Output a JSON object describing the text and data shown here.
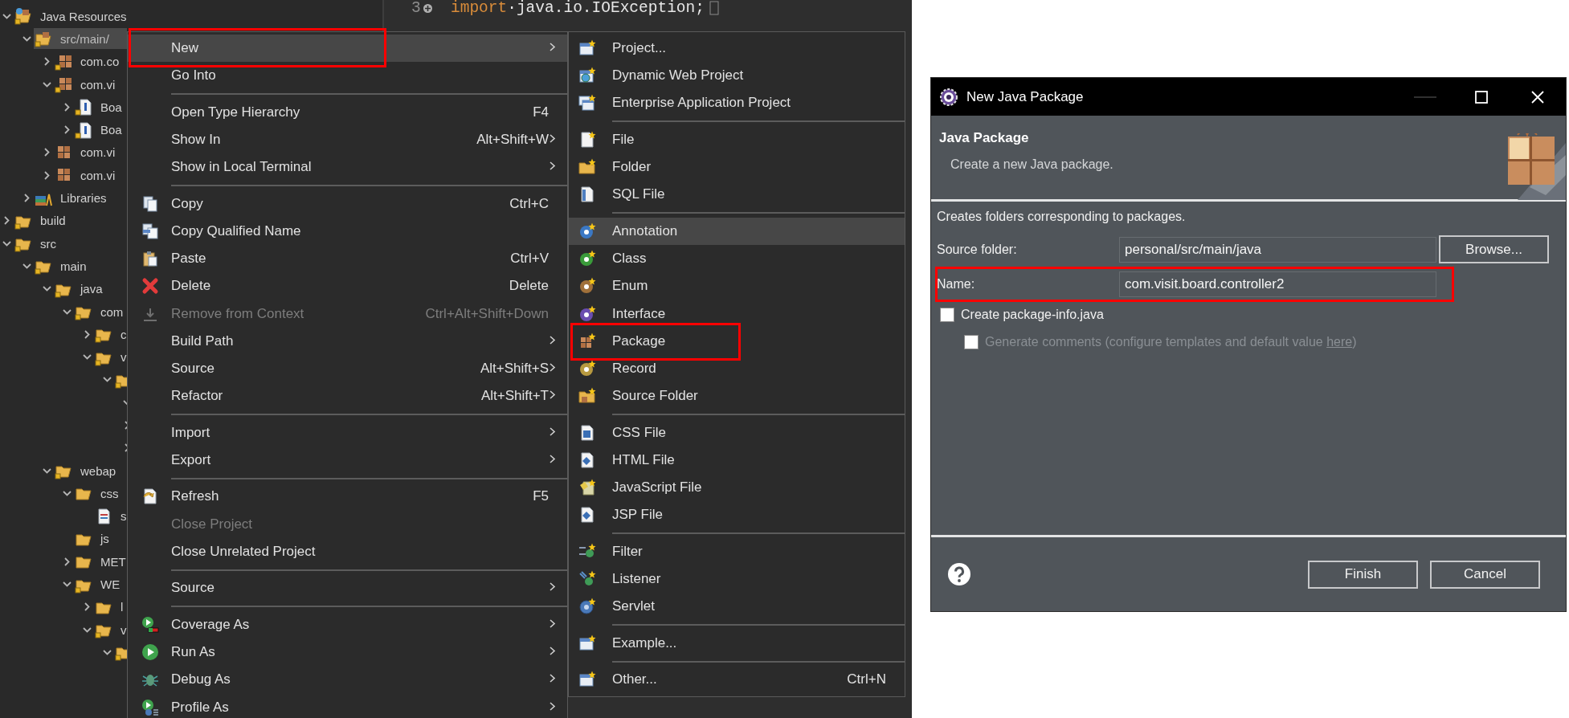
{
  "explorer": {
    "tree": [
      {
        "label": "Java Resources",
        "kind": "resources",
        "expanded": true,
        "selected": false,
        "children": [
          {
            "label": "src/main/",
            "kind": "source_folder",
            "expanded": true,
            "selected": true,
            "children": [
              {
                "label": "com.co",
                "kind": "package",
                "expanded": false,
                "selected": false
              },
              {
                "label": "com.vi",
                "kind": "package",
                "expanded": true,
                "selected": false,
                "children": [
                  {
                    "label": "Boa",
                    "kind": "java_file",
                    "expanded": false,
                    "selected": false
                  },
                  {
                    "label": "Boa",
                    "kind": "java_file",
                    "expanded": false,
                    "selected": false
                  }
                ]
              },
              {
                "label": "com.vi",
                "kind": "empty_package",
                "expanded": false,
                "selected": false
              },
              {
                "label": "com.vi",
                "kind": "empty_package",
                "expanded": false,
                "selected": false
              }
            ]
          },
          {
            "label": "Libraries",
            "kind": "library",
            "expanded": false,
            "selected": false
          }
        ]
      },
      {
        "label": "build",
        "kind": "folder",
        "expanded": false,
        "selected": false
      },
      {
        "label": "src",
        "kind": "folder",
        "expanded": true,
        "selected": false,
        "children": [
          {
            "label": "main",
            "kind": "folder",
            "expanded": true,
            "selected": false,
            "children": [
              {
                "label": "java",
                "kind": "folder",
                "expanded": true,
                "selected": false,
                "children": [
                  {
                    "label": "com",
                    "kind": "folder",
                    "expanded": true,
                    "selected": false,
                    "children": [
                      {
                        "label": "c",
                        "kind": "folder",
                        "expanded": false,
                        "selected": false
                      },
                      {
                        "label": "v",
                        "kind": "folder",
                        "expanded": true,
                        "selected": false,
                        "children": [
                          {
                            "kind": "folder",
                            "expanded": true,
                            "selected": false,
                            "children": [
                              {
                                "expanded": true
                              },
                              {
                                "expanded": false
                              },
                              {
                                "expanded": false
                              }
                            ]
                          }
                        ]
                      }
                    ]
                  }
                ]
              },
              {
                "label": "webap",
                "kind": "folder",
                "expanded": true,
                "selected": false,
                "children": [
                  {
                    "label": "css",
                    "kind": "plain_folder",
                    "expanded": true,
                    "selected": false,
                    "children": [
                      {
                        "label": "s",
                        "kind": "file",
                        "selected": false
                      }
                    ]
                  },
                  {
                    "label": "js",
                    "kind": "plain_folder",
                    "selected": false
                  },
                  {
                    "label": "MET",
                    "kind": "plain_folder",
                    "expanded": false,
                    "selected": false
                  },
                  {
                    "label": "WE",
                    "kind": "folder",
                    "expanded": true,
                    "selected": false,
                    "children": [
                      {
                        "label": "l",
                        "kind": "plain_folder",
                        "expanded": false,
                        "selected": false
                      },
                      {
                        "label": "v",
                        "kind": "folder",
                        "expanded": true,
                        "selected": false,
                        "children": [
                          {
                            "kind": "folder",
                            "expanded": true,
                            "selected": false
                          }
                        ]
                      }
                    ]
                  }
                ]
              }
            ]
          }
        ]
      }
    ]
  },
  "editor": {
    "lines": [
      {
        "number": "3",
        "parts": [
          {
            "kind": "keyword",
            "text": "import"
          },
          {
            "kind": "plain",
            "text": "·java.io.IOException;"
          }
        ]
      }
    ]
  },
  "context_menu": {
    "items": [
      {
        "kind": "item",
        "label": "New",
        "selected": true,
        "disabled": false,
        "submenu": true,
        "highlighted": true
      },
      {
        "kind": "item",
        "label": "Go Into",
        "selected": false,
        "disabled": false,
        "submenu": false,
        "highlighted": false
      },
      {
        "kind": "separator"
      },
      {
        "kind": "item",
        "label": "Open Type Hierarchy",
        "shortcut": "F4",
        "selected": false,
        "disabled": false,
        "submenu": false,
        "highlighted": false
      },
      {
        "kind": "item",
        "label": "Show In",
        "shortcut": "Alt+Shift+W",
        "selected": false,
        "disabled": false,
        "submenu": true,
        "highlighted": false
      },
      {
        "kind": "item",
        "label": "Show in Local Terminal",
        "selected": false,
        "disabled": false,
        "submenu": true,
        "highlighted": false
      },
      {
        "kind": "separator"
      },
      {
        "kind": "item",
        "label": "Copy",
        "shortcut": "Ctrl+C",
        "selected": false,
        "disabled": false,
        "submenu": false,
        "highlighted": false
      },
      {
        "kind": "item",
        "label": "Copy Qualified Name",
        "selected": false,
        "disabled": false,
        "submenu": false,
        "highlighted": false
      },
      {
        "kind": "item",
        "label": "Paste",
        "shortcut": "Ctrl+V",
        "selected": false,
        "disabled": false,
        "submenu": false,
        "highlighted": false
      },
      {
        "kind": "item",
        "label": "Delete",
        "shortcut": "Delete",
        "selected": false,
        "disabled": false,
        "submenu": false,
        "highlighted": false
      },
      {
        "kind": "item",
        "label": "Remove from Context",
        "shortcut": "Ctrl+Alt+Shift+Down",
        "selected": false,
        "disabled": true,
        "submenu": false,
        "highlighted": false
      },
      {
        "kind": "item",
        "label": "Build Path",
        "selected": false,
        "disabled": false,
        "submenu": true,
        "highlighted": false
      },
      {
        "kind": "item",
        "label": "Source",
        "shortcut": "Alt+Shift+S",
        "selected": false,
        "disabled": false,
        "submenu": true,
        "highlighted": false
      },
      {
        "kind": "item",
        "label": "Refactor",
        "shortcut": "Alt+Shift+T",
        "selected": false,
        "disabled": false,
        "submenu": true,
        "highlighted": false
      },
      {
        "kind": "separator"
      },
      {
        "kind": "item",
        "label": "Import",
        "selected": false,
        "disabled": false,
        "submenu": true,
        "highlighted": false
      },
      {
        "kind": "item",
        "label": "Export",
        "selected": false,
        "disabled": false,
        "submenu": true,
        "highlighted": false
      },
      {
        "kind": "separator"
      },
      {
        "kind": "item",
        "label": "Refresh",
        "shortcut": "F5",
        "selected": false,
        "disabled": false,
        "submenu": false,
        "highlighted": false
      },
      {
        "kind": "item",
        "label": "Close Project",
        "selected": false,
        "disabled": true,
        "submenu": false,
        "highlighted": false
      },
      {
        "kind": "item",
        "label": "Close Unrelated Project",
        "selected": false,
        "disabled": false,
        "submenu": false,
        "highlighted": false
      },
      {
        "kind": "separator"
      },
      {
        "kind": "item",
        "label": "Source",
        "selected": false,
        "disabled": false,
        "submenu": true,
        "highlighted": false
      },
      {
        "kind": "separator"
      },
      {
        "kind": "item",
        "label": "Coverage As",
        "selected": false,
        "disabled": false,
        "submenu": true,
        "highlighted": false
      },
      {
        "kind": "item",
        "label": "Run As",
        "selected": false,
        "disabled": false,
        "submenu": true,
        "highlighted": false
      },
      {
        "kind": "item",
        "label": "Debug As",
        "selected": false,
        "disabled": false,
        "submenu": true,
        "highlighted": false
      },
      {
        "kind": "item",
        "label": "Profile As",
        "selected": false,
        "disabled": false,
        "submenu": true,
        "highlighted": false
      }
    ]
  },
  "submenu": {
    "items": [
      {
        "kind": "item",
        "label": "Project...",
        "selected": false,
        "highlighted": false
      },
      {
        "kind": "item",
        "label": "Dynamic Web Project",
        "selected": false,
        "highlighted": false
      },
      {
        "kind": "item",
        "label": "Enterprise Application Project",
        "selected": false,
        "highlighted": false
      },
      {
        "kind": "separator"
      },
      {
        "kind": "item",
        "label": "File",
        "selected": false,
        "highlighted": false
      },
      {
        "kind": "item",
        "label": "Folder",
        "selected": false,
        "highlighted": false
      },
      {
        "kind": "item",
        "label": "SQL File",
        "selected": false,
        "highlighted": false
      },
      {
        "kind": "separator"
      },
      {
        "kind": "item",
        "label": "Annotation",
        "selected": true,
        "highlighted": false
      },
      {
        "kind": "item",
        "label": "Class",
        "selected": false,
        "highlighted": false
      },
      {
        "kind": "item",
        "label": "Enum",
        "selected": false,
        "highlighted": false
      },
      {
        "kind": "item",
        "label": "Interface",
        "selected": false,
        "highlighted": false
      },
      {
        "kind": "item",
        "label": "Package",
        "selected": false,
        "highlighted": true
      },
      {
        "kind": "item",
        "label": "Record",
        "selected": false,
        "highlighted": false
      },
      {
        "kind": "item",
        "label": "Source Folder",
        "selected": false,
        "highlighted": false
      },
      {
        "kind": "separator"
      },
      {
        "kind": "item",
        "label": "CSS File",
        "selected": false,
        "highlighted": false
      },
      {
        "kind": "item",
        "label": "HTML File",
        "selected": false,
        "highlighted": false
      },
      {
        "kind": "item",
        "label": "JavaScript File",
        "selected": false,
        "highlighted": false
      },
      {
        "kind": "item",
        "label": "JSP File",
        "selected": false,
        "highlighted": false
      },
      {
        "kind": "separator"
      },
      {
        "kind": "item",
        "label": "Filter",
        "selected": false,
        "highlighted": false
      },
      {
        "kind": "item",
        "label": "Listener",
        "selected": false,
        "highlighted": false
      },
      {
        "kind": "item",
        "label": "Servlet",
        "selected": false,
        "highlighted": false
      },
      {
        "kind": "separator"
      },
      {
        "kind": "item",
        "label": "Example...",
        "selected": false,
        "highlighted": false
      },
      {
        "kind": "separator"
      },
      {
        "kind": "item",
        "label": "Other...",
        "shortcut": "Ctrl+N",
        "selected": false,
        "highlighted": false
      }
    ]
  },
  "dialog": {
    "title": "New Java Package",
    "window_controls": [
      {
        "kind": "minimize",
        "disabled": true
      },
      {
        "kind": "maximize",
        "disabled": false
      },
      {
        "kind": "close",
        "disabled": false
      }
    ],
    "heading": "Java Package",
    "subtitle": "Create a new Java package.",
    "description": "Creates folders corresponding to packages.",
    "fields": [
      {
        "label": "Source folder:",
        "value": "personal/src/main/java",
        "button": "Browse...",
        "highlighted": false
      },
      {
        "label": "Name:",
        "value": "com.visit.board.controller2",
        "highlighted": true
      }
    ],
    "checkboxes": [
      {
        "label": "Create package-info.java",
        "checked": false,
        "disabled": false,
        "children": [
          {
            "label": "Generate comments (configure templates and default value ",
            "link": "here",
            "label_end": ")",
            "checked": false,
            "disabled": true
          }
        ]
      }
    ],
    "buttons": [
      "Finish",
      "Cancel"
    ]
  }
}
